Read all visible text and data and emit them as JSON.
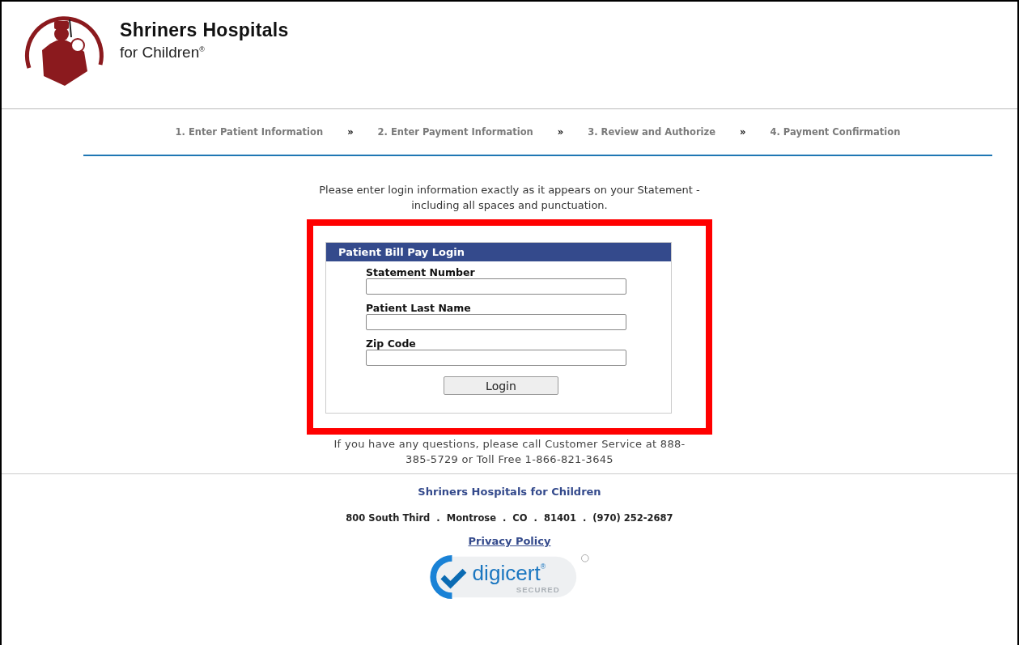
{
  "header": {
    "title": "Shriners Hospitals",
    "subtitle": "for Children",
    "mark": "®"
  },
  "steps": {
    "separator": "»",
    "items": [
      "1. Enter Patient Information",
      "2. Enter Payment Information",
      "3. Review and Authorize",
      "4. Payment Confirmation"
    ]
  },
  "intro": "Please enter login information exactly as it appears on your Statement - including all spaces and punctuation.",
  "login": {
    "title": "Patient Bill Pay Login",
    "fields": [
      {
        "label": "Statement Number"
      },
      {
        "label": "Patient Last Name"
      },
      {
        "label": "Zip Code"
      }
    ],
    "button": "Login"
  },
  "help": "If you have any questions, please call Customer Service at 888-385-5729 or Toll Free 1-866-821-3645",
  "footer": {
    "name": "Shriners Hospitals for Children",
    "address": "800 South Third  .  Montrose  .  CO  .  81401  .  (970) 252-2687",
    "link": "Privacy Policy",
    "seal": {
      "brand": "digicert",
      "mark": "®",
      "caption": "SECURED"
    }
  }
}
